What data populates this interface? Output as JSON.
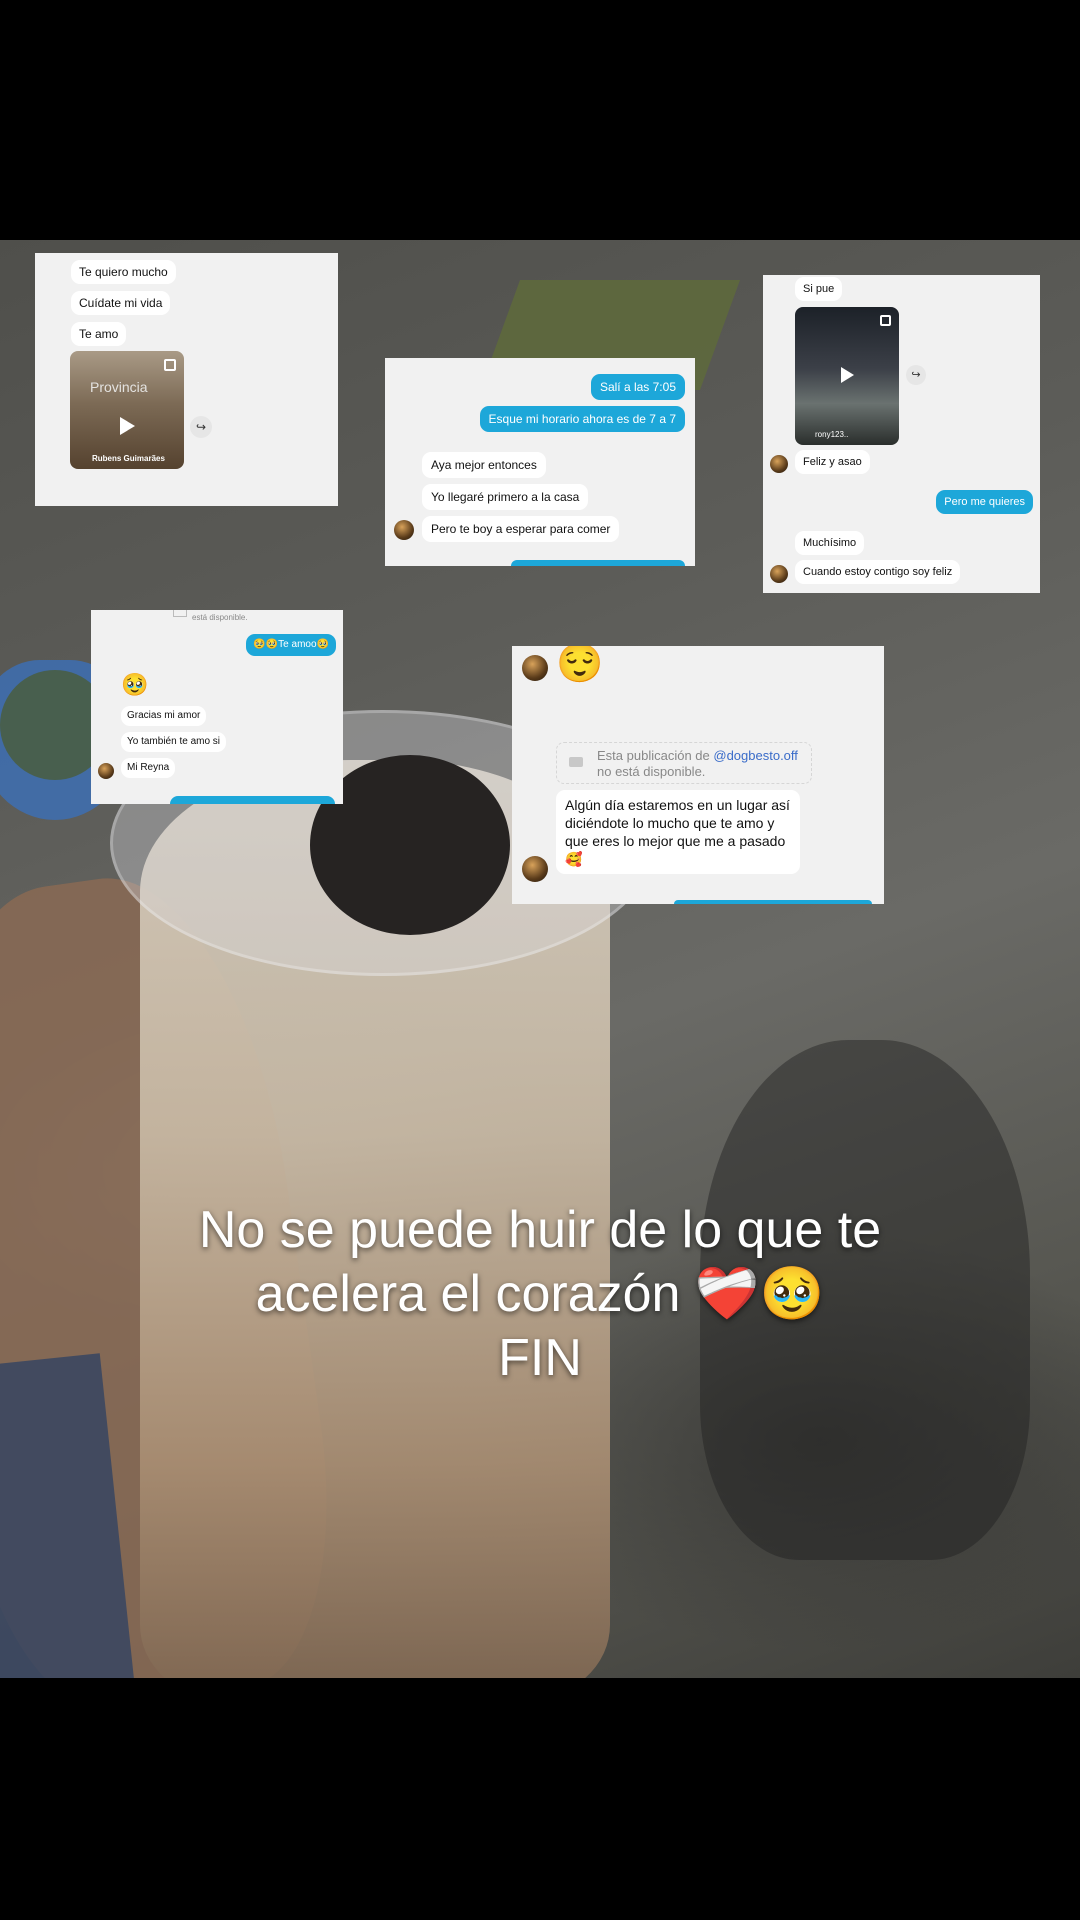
{
  "shot1": {
    "messages": [
      "Te quiero mucho",
      "Cuídate mi vida",
      "Te amo"
    ],
    "video_caption": "Provincia",
    "video_author": "Rubens Guimarães",
    "share_glyph": "↪"
  },
  "shot2": {
    "sent": [
      "Salí a las 7:05",
      "Esque mi horario ahora es de 7 a 7"
    ],
    "received": [
      "Aya mejor entonces",
      "Yo llegaré primero a la casa",
      "Pero te boy a esperar para comer"
    ]
  },
  "shot3": {
    "received_top": "Si pue",
    "video_author": "rony123..",
    "received_mid": "Feliz y asao",
    "sent": "Pero me quieres",
    "received_bottom": [
      "Muchísimo",
      "Cuando estoy contigo soy feliz"
    ],
    "share_glyph": "↪"
  },
  "shot4": {
    "unavailable": "está disponible.",
    "sent": "🥹🥹Te amoo🥹",
    "emoji": "🥹",
    "received": [
      "Gracias mi amor",
      "Yo también te amo si",
      "Mi Reyna"
    ]
  },
  "shot5": {
    "emoji": "😌",
    "unavailable_prefix": "Esta publicación de",
    "unavailable_handle": "@dogbesto.off",
    "unavailable_suffix": "no está disponible.",
    "message": "Algún día estaremos en un lugar así diciéndote lo mucho que te amo y que eres lo mejor que me a pasado 🥰"
  },
  "caption": {
    "line1": "No se puede huir de lo que te",
    "line2": "acelera el corazón ❤️‍🩹🥹",
    "line3": "FIN"
  },
  "colors": {
    "sent_bubble": "#1da7d9",
    "received_bubble": "#ffffff",
    "chat_bg": "#f1f1f1",
    "handle_link": "#3a6cc9"
  },
  "icons": [
    "play-icon",
    "share-icon",
    "video-camera-icon",
    "multi-select-icon"
  ]
}
